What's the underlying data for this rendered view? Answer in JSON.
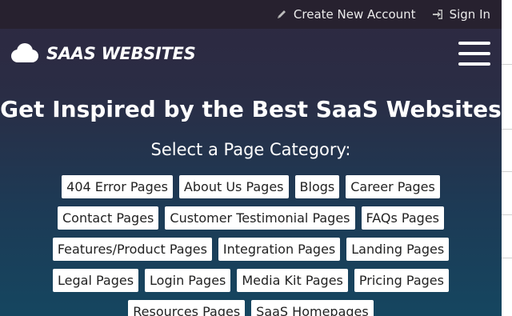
{
  "topbar": {
    "create_account": "Create New Account",
    "sign_in": "Sign In"
  },
  "header": {
    "logo_text": "SAAS WEBSITES"
  },
  "main": {
    "title": "Get Inspired by the Best SaaS Websites",
    "subtitle": "Select a Page Category:",
    "categories": [
      "404 Error Pages",
      "About Us Pages",
      "Blogs",
      "Career Pages",
      "Contact Pages",
      "Customer Testimonial Pages",
      "FAQs Pages",
      "Features/Product Pages",
      "Integration Pages",
      "Landing Pages",
      "Legal Pages",
      "Login Pages",
      "Media Kit Pages",
      "Pricing Pages",
      "Resources Pages",
      "SaaS Homepages"
    ]
  },
  "colors": {
    "topbar_bg": "#27212f",
    "gradient_top": "#2e2840",
    "gradient_bottom": "#154660",
    "tag_bg": "#ffffff",
    "text": "#ffffff"
  },
  "icons": {
    "create_account": "pencil-icon",
    "sign_in": "sign-in-icon",
    "logo": "cloud-icon",
    "menu": "hamburger-menu-icon"
  }
}
